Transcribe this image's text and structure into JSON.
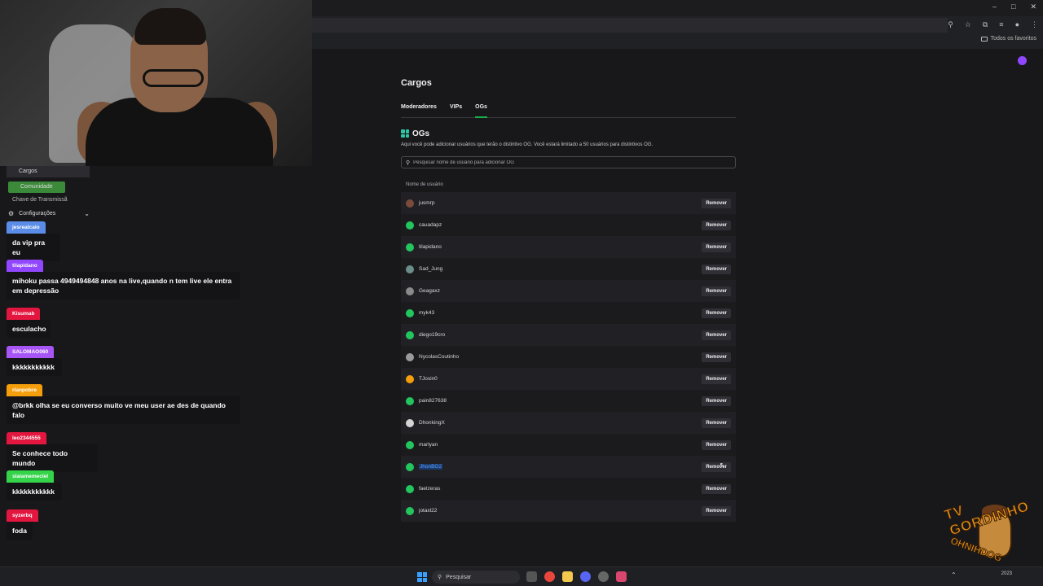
{
  "browser": {
    "window_controls": [
      "–",
      "□",
      "✕"
    ],
    "bookmarks_label": "Todos os favoritos"
  },
  "sidebar": {
    "items": [
      {
        "label": "Cargos",
        "active": true
      },
      {
        "label": "Comunidade"
      }
    ],
    "overlap_text": "Chave de Transmissã",
    "config_label": "Configurações"
  },
  "chat": {
    "messages": [
      {
        "user": "jesrealcaio",
        "user_color": "#5b8de8",
        "text": "da vip pra eu"
      },
      {
        "user": "tilapidano",
        "user_color": "#9147ff",
        "text": "mihoku passa 4949494848 anos na live,quando n tem live ele entra em depressão"
      },
      {
        "user": "Kisumab",
        "user_color": "#e3163f",
        "text": "esculacho"
      },
      {
        "user": "SALOMAO060",
        "user_color": "#a855f7",
        "text": "kkkkkkkkkkk"
      },
      {
        "user": "rlanpobre",
        "user_color": "#f59e0b",
        "text": "@brkk olha se eu converso muito ve meu user ae des de quando falo"
      },
      {
        "user": "leo2344555",
        "user_color": "#e3163f",
        "text": "Se conhece todo mundo"
      },
      {
        "user": "slalamemeclel",
        "user_color": "#34d34a",
        "text": "kkkkkkkkkkk"
      },
      {
        "user": "syzerbq",
        "user_color": "#e3163f",
        "text": "foda"
      }
    ]
  },
  "main": {
    "title": "Cargos",
    "tabs": [
      "Moderadores",
      "VIPs",
      "OGs"
    ],
    "active_tab": "OGs",
    "og_title": "OGs",
    "og_description": "Aqui você pode adicionar usuários que terão o distintivo OG. Você estará limitado a 50 usuários para distintivos OG.",
    "search_placeholder": "Pesquisar nome de usuário para adicionar OG",
    "column_header": "Nome de usuário",
    "remove_label": "Remover",
    "users": [
      {
        "name": "jusmrp",
        "avatar_color": "#7a4b3a"
      },
      {
        "name": "cauadapz",
        "avatar_color": "#22c55e"
      },
      {
        "name": "tilapidano",
        "avatar_color": "#22c55e"
      },
      {
        "name": "Sad_Jung",
        "avatar_color": "#6b8e8a"
      },
      {
        "name": "Geagaxz",
        "avatar_color": "#8a8a8a"
      },
      {
        "name": "myk43",
        "avatar_color": "#22c55e"
      },
      {
        "name": "diego19cro",
        "avatar_color": "#22c55e"
      },
      {
        "name": "NycolasCoutinho",
        "avatar_color": "#9a9a9a"
      },
      {
        "name": "TJosin0",
        "avatar_color": "#f59e0b"
      },
      {
        "name": "pain827638",
        "avatar_color": "#22c55e"
      },
      {
        "name": "DhonkingX",
        "avatar_color": "#d4d4d4"
      },
      {
        "name": "marlyan",
        "avatar_color": "#22c55e"
      },
      {
        "name": "JhonBG2",
        "avatar_color": "#22c55e",
        "selected": true
      },
      {
        "name": "faelzeras",
        "avatar_color": "#22c55e"
      },
      {
        "name": "jotaxl22",
        "avatar_color": "#22c55e"
      }
    ]
  },
  "overlay_logo": {
    "top_text": "TV GORDINHO",
    "bottom_text": "OHNIHDOG"
  },
  "taskbar": {
    "search_label": "Pesquisar",
    "clock_date": "2023"
  }
}
